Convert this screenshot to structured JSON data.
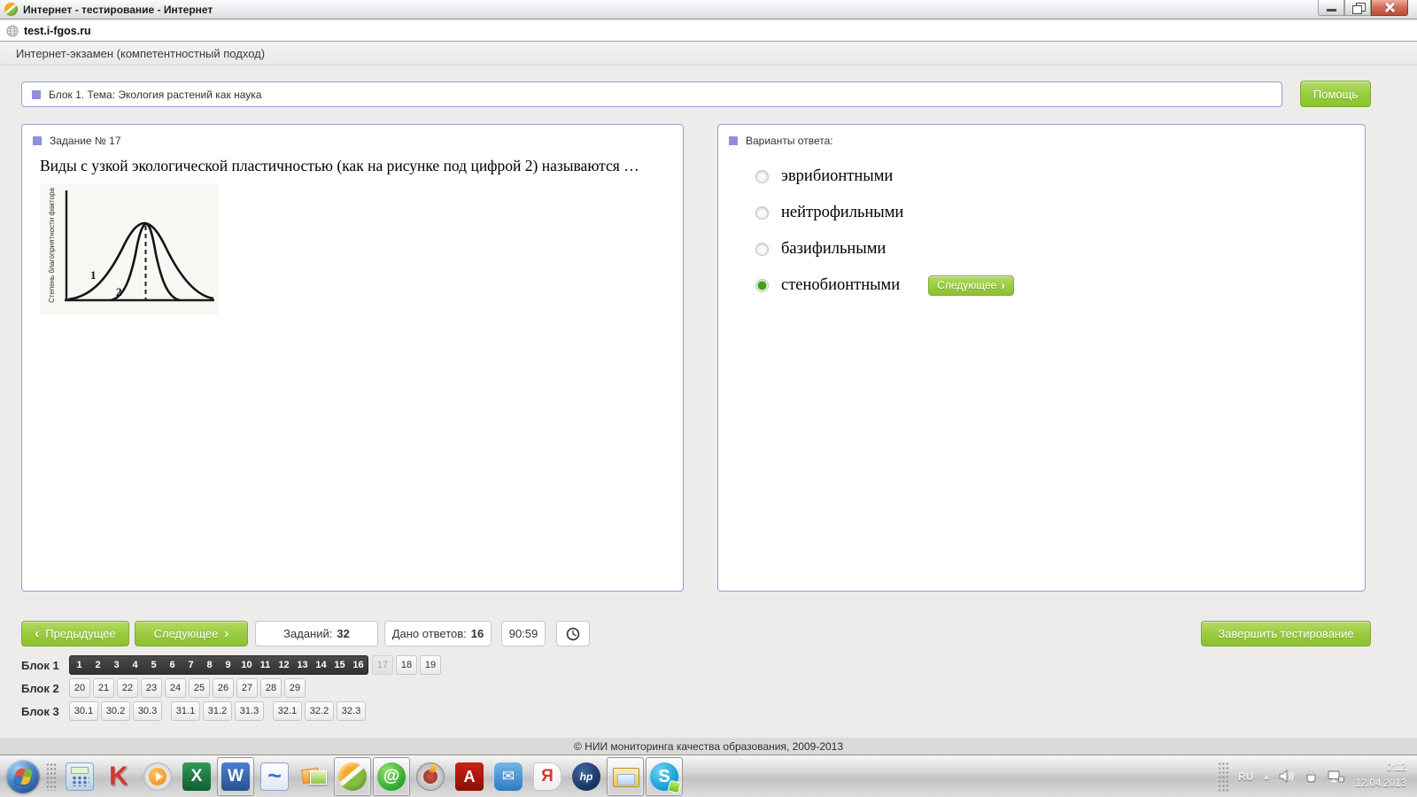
{
  "window": {
    "title": "Интернет - тестирование - Интернет",
    "url": "test.i-fgos.ru",
    "app_header": "Интернет-экзамен (компетентностный подход)"
  },
  "topic_bar": {
    "title": "Блок 1. Тема: Экология растений как наука",
    "help_button": "Помощь"
  },
  "question_panel": {
    "header": "Задание № 17",
    "text": "Виды с узкой экологической пластичностью (как на рисунке под цифрой 2) называются …",
    "figure": {
      "y_axis_label": "Степень благоприятности фактора",
      "curve_labels": [
        "1",
        "2"
      ]
    }
  },
  "answers_panel": {
    "header": "Варианты ответа:",
    "options": [
      {
        "label": "эврибионтными",
        "selected": false
      },
      {
        "label": "нейтрофильными",
        "selected": false
      },
      {
        "label": "базифильными",
        "selected": false
      },
      {
        "label": "стенобионтными",
        "selected": true
      }
    ],
    "inline_next_button": "Следующее"
  },
  "controls": {
    "prev_button": "Предыдущее",
    "next_button": "Следующее",
    "tasks_label": "Заданий:",
    "tasks_value": "32",
    "answered_label": "Дано ответов:",
    "answered_value": "16",
    "timer": "90:59",
    "finish_button": "Завершить тестирование"
  },
  "blocks": [
    {
      "label": "Блок 1",
      "items": [
        {
          "t": "1",
          "state": "answered"
        },
        {
          "t": "2",
          "state": "answered"
        },
        {
          "t": "3",
          "state": "answered"
        },
        {
          "t": "4",
          "state": "answered"
        },
        {
          "t": "5",
          "state": "answered"
        },
        {
          "t": "6",
          "state": "answered"
        },
        {
          "t": "7",
          "state": "answered"
        },
        {
          "t": "8",
          "state": "answered"
        },
        {
          "t": "9",
          "state": "answered"
        },
        {
          "t": "10",
          "state": "answered"
        },
        {
          "t": "11",
          "state": "answered"
        },
        {
          "t": "12",
          "state": "answered"
        },
        {
          "t": "13",
          "state": "answered"
        },
        {
          "t": "14",
          "state": "answered"
        },
        {
          "t": "15",
          "state": "answered"
        },
        {
          "t": "16",
          "state": "answered"
        },
        {
          "t": "17",
          "state": "current"
        },
        {
          "t": "18",
          "state": "normal"
        },
        {
          "t": "19",
          "state": "normal"
        }
      ]
    },
    {
      "label": "Блок 2",
      "items": [
        {
          "t": "20"
        },
        {
          "t": "21"
        },
        {
          "t": "22"
        },
        {
          "t": "23"
        },
        {
          "t": "24"
        },
        {
          "t": "25"
        },
        {
          "t": "26"
        },
        {
          "t": "27"
        },
        {
          "t": "28"
        },
        {
          "t": "29"
        }
      ]
    },
    {
      "label": "Блок 3",
      "wide": true,
      "items": [
        {
          "t": "30.1"
        },
        {
          "t": "30.2"
        },
        {
          "t": "30.3"
        },
        {
          "t": "31.1",
          "gap": true
        },
        {
          "t": "31.2"
        },
        {
          "t": "31.3"
        },
        {
          "t": "32.1",
          "gap": true
        },
        {
          "t": "32.2"
        },
        {
          "t": "32.3"
        }
      ]
    }
  ],
  "footer": "© НИИ мониторинга качества образования, 2009-2013",
  "taskbar": {
    "buttons": [
      {
        "name": "start-button",
        "style": "orb"
      },
      {
        "name": "quick-launch-dots-icon",
        "style": "dots",
        "interactable": false
      },
      {
        "name": "calculator-icon",
        "style": "calc"
      },
      {
        "name": "kaspersky-icon",
        "style": "k",
        "glyph": "K"
      },
      {
        "name": "media-player-icon",
        "style": "media"
      },
      {
        "name": "excel-icon",
        "style": "excel",
        "glyph": "X"
      },
      {
        "name": "word-icon",
        "style": "word",
        "glyph": "W",
        "open": true
      },
      {
        "name": "corel-icon",
        "style": "corel",
        "glyph": "~"
      },
      {
        "name": "photo-viewer-icon",
        "style": "photo"
      },
      {
        "name": "browser-icon",
        "style": "sphere",
        "open": true
      },
      {
        "name": "mailru-agent-icon",
        "style": "mailru",
        "glyph": "@",
        "open": true
      },
      {
        "name": "security-app-icon",
        "style": "fire"
      },
      {
        "name": "adobe-reader-icon",
        "style": "adobe",
        "glyph": "A"
      },
      {
        "name": "mail-icon",
        "style": "mail",
        "glyph": "✉"
      },
      {
        "name": "yandex-icon",
        "style": "yandex",
        "glyph": "Я"
      },
      {
        "name": "hp-icon",
        "style": "hp",
        "glyph": "hp"
      },
      {
        "name": "explorer-icon",
        "style": "folder",
        "open": true
      },
      {
        "name": "skype-icon",
        "style": "skype",
        "glyph": "S",
        "open": true
      }
    ],
    "tray": {
      "lang": "RU",
      "time": "0:12",
      "date": "12.04.2013"
    }
  },
  "colors": {
    "accent_green": "#8cc232",
    "panel_border": "#9c9cd9",
    "answered_dark": "#3a3a3a",
    "selected_radio_green": "#46a414",
    "close_red": "#b84c38"
  }
}
